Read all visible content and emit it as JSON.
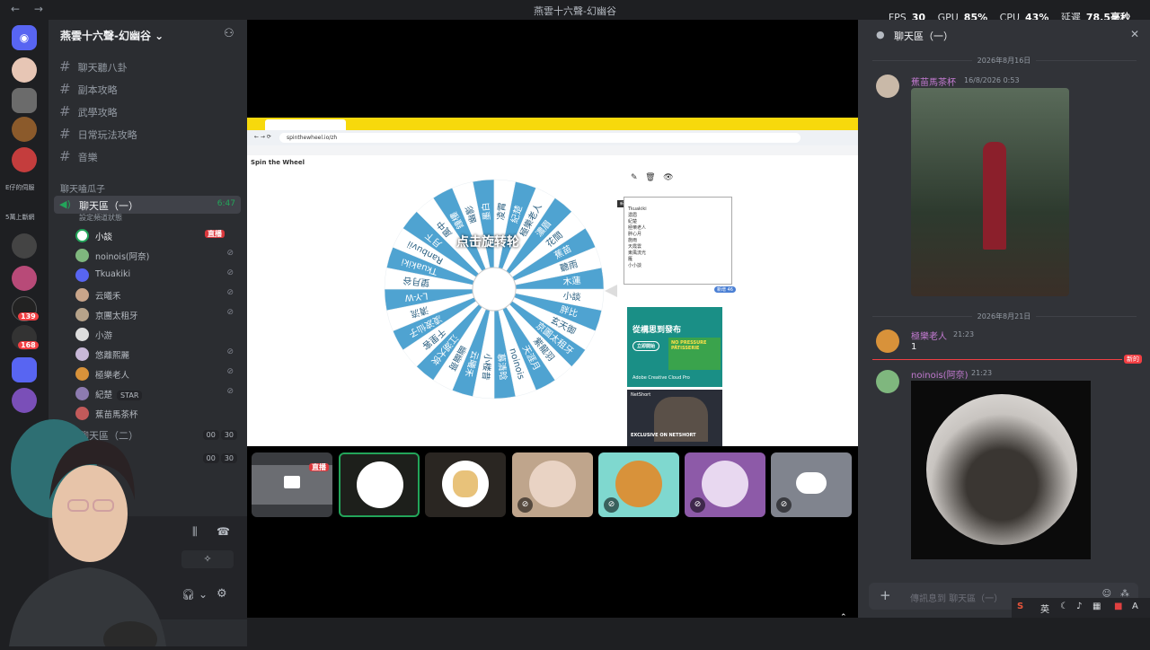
{
  "titlebar": {
    "title": "燕雲十六聲-幻幽谷"
  },
  "perf": {
    "fps_label": "FPS",
    "fps": "30",
    "gpu_label": "GPU",
    "gpu": "85%",
    "cpu_label": "CPU",
    "cpu": "43%",
    "latency_label": "延遲",
    "latency": "78.5毫秒"
  },
  "rail": {
    "badges": [
      "139",
      "168"
    ],
    "labels": [
      "E仔的伺服",
      "5萬上斷網"
    ]
  },
  "sidebar": {
    "server_name": "燕雲十六聲-幻幽谷",
    "text_channels": [
      "聊天聽八卦",
      "副本攻略",
      "武學攻略",
      "日常玩法攻略",
      "音樂"
    ],
    "category": "聊天嗑瓜子",
    "voice_channel": {
      "name": "聊天區（一）",
      "time": "6:47",
      "status": "設定頻道狀態"
    },
    "members": [
      {
        "name": "小談",
        "live": "直播"
      },
      {
        "name": "noinois(阿奈)"
      },
      {
        "name": "Tkuakiki"
      },
      {
        "name": "云曦禾"
      },
      {
        "name": "京團太租牙"
      },
      {
        "name": "小游"
      },
      {
        "name": "悠離熙麗"
      },
      {
        "name": "極樂老人"
      },
      {
        "name": "紀楚",
        "tag": "STAR"
      },
      {
        "name": "蕉苗馬茶杯"
      }
    ],
    "voice_channel_2": {
      "name": "聊天區（二）",
      "counts": [
        "00",
        "30"
      ]
    },
    "voice_channel_3": {
      "counts": [
        "00",
        "30"
      ]
    }
  },
  "browser": {
    "url": "spinthewheel.io/zh",
    "logo": "Spin the Wheel",
    "wheel_center_text": "点击旋转轮",
    "wheel_segments": [
      "小談",
      "胖比",
      "玄天御",
      "京圖太租牙",
      "紫龍羽",
      "天涯月",
      "noinois",
      "慕清晗",
      "小楼昔",
      "云曦禾",
      "幽幽哥",
      "江湖大俠",
      "千里客",
      "凌波仙子",
      "清流",
      "L-Y-W",
      "望月谷",
      "Tkuakiki",
      "Ranbuvii",
      "月下",
      "風中",
      "鐘樓",
      "幽影",
      "墨白",
      "凌霄",
      "紀楚",
      "極樂老人",
      "濃眉",
      "花間",
      "蕉苗",
      "聽雨",
      "木蓮"
    ],
    "entries": [
      "Tkuakiki",
      "濃眉",
      "紀楚",
      "極樂老人",
      "胖心月",
      "施雨",
      "天霞雲",
      "東風流光",
      "雁",
      "小小談"
    ],
    "tooltip": "新增",
    "counter": "新增 46",
    "ad1_title": "從構思到發布",
    "ad1_btn": "立即開始",
    "ad1_brand": "Adobe Creative Cloud Pro",
    "ad1_art": "NO PRESSURE PÂTISSERIE",
    "ad2_brand": "NetShort",
    "ad2_text": "EXCLUSIVE ON NETSHORT"
  },
  "tiles": {
    "live": "直播"
  },
  "chat": {
    "title": "聊天區（一）",
    "date1": "2026年8月16日",
    "msg1": {
      "user": "蕉苗馬茶杯",
      "time": "16/8/2026 0:53"
    },
    "date2": "2026年8月21日",
    "msg2": {
      "user": "極樂老人",
      "time": "21:23",
      "text": "1"
    },
    "new_badge": "新的",
    "msg3": {
      "user": "noinois(阿奈)",
      "time": "21:23"
    },
    "composer_placeholder": "傳訊息到 聊天區（一）"
  },
  "taskbar": {
    "ime": "英"
  },
  "colors": {
    "accent": "#5865f2",
    "live": "#da373c",
    "chat_user": "#c27ad0",
    "speaking": "#23a55a",
    "wheel_blue": "#4fa3d1"
  }
}
